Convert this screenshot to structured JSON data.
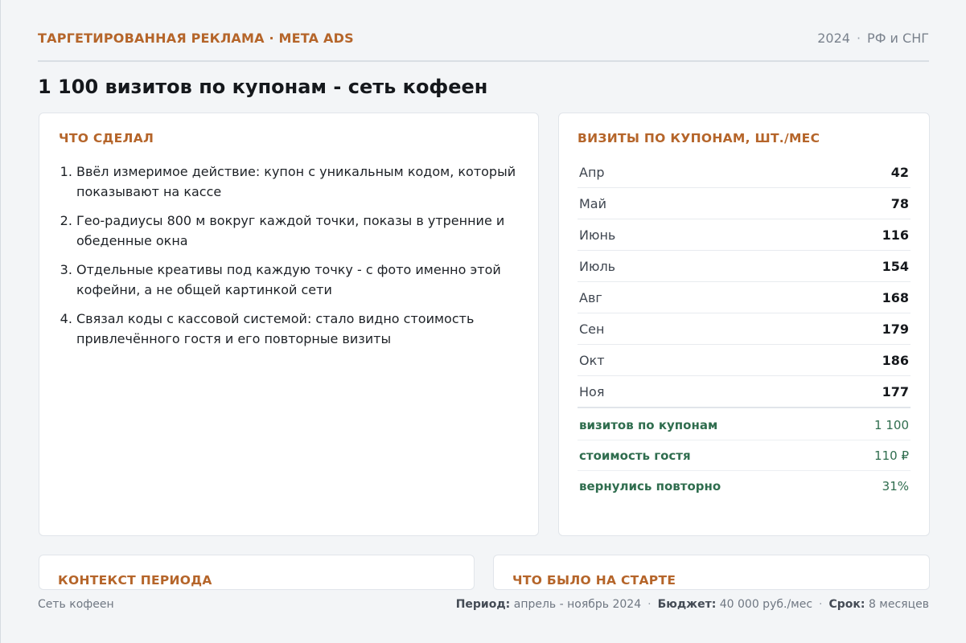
{
  "header": {
    "eyebrow": "ТАРГЕТИРОВАННАЯ РЕКЛАМА · META ADS",
    "year": "2024",
    "region": "РФ и СНГ"
  },
  "title": "1 100 визитов по купонам - сеть кофеен",
  "what_done": {
    "title": "Что сделал",
    "steps": [
      "Ввёл измеримое действие: купон с уникальным кодом, который показывают на кассе",
      "Гео-радиусы 800 м вокруг каждой точки, показы в утренние и обеденные окна",
      "Отдельные креативы под каждую точку - с фото именно этой кофейни, а не общей картинкой сети",
      "Связал коды с кассовой системой: стало видно стоимость привлечённого гостя и его повторные визиты"
    ]
  },
  "visits": {
    "title": "Визиты по купонам, шт./мес",
    "months": [
      {
        "month": "Апр",
        "value": "42"
      },
      {
        "month": "Май",
        "value": "78"
      },
      {
        "month": "Июнь",
        "value": "116"
      },
      {
        "month": "Июль",
        "value": "154"
      },
      {
        "month": "Авг",
        "value": "168"
      },
      {
        "month": "Сен",
        "value": "179"
      },
      {
        "month": "Окт",
        "value": "186"
      },
      {
        "month": "Ноя",
        "value": "177"
      }
    ],
    "totals": [
      {
        "label": "визитов по купонам",
        "value": "1 100"
      },
      {
        "label": "стоимость гостя",
        "value": "110 ₽"
      },
      {
        "label": "вернулись повторно",
        "value": "31%"
      }
    ]
  },
  "context": {
    "title": "Контекст периода"
  },
  "start": {
    "title": "Что было на старте"
  },
  "footer": {
    "client": "Сеть кофеен",
    "period_label": "Период:",
    "period_value": "апрель - ноябрь 2024",
    "budget_label": "Бюджет:",
    "budget_value": "40 000 руб./мес",
    "term_label": "Срок:",
    "term_value": "8 месяцев"
  },
  "colors": {
    "accent": "#b5652a",
    "positive": "#2f6d4e"
  }
}
